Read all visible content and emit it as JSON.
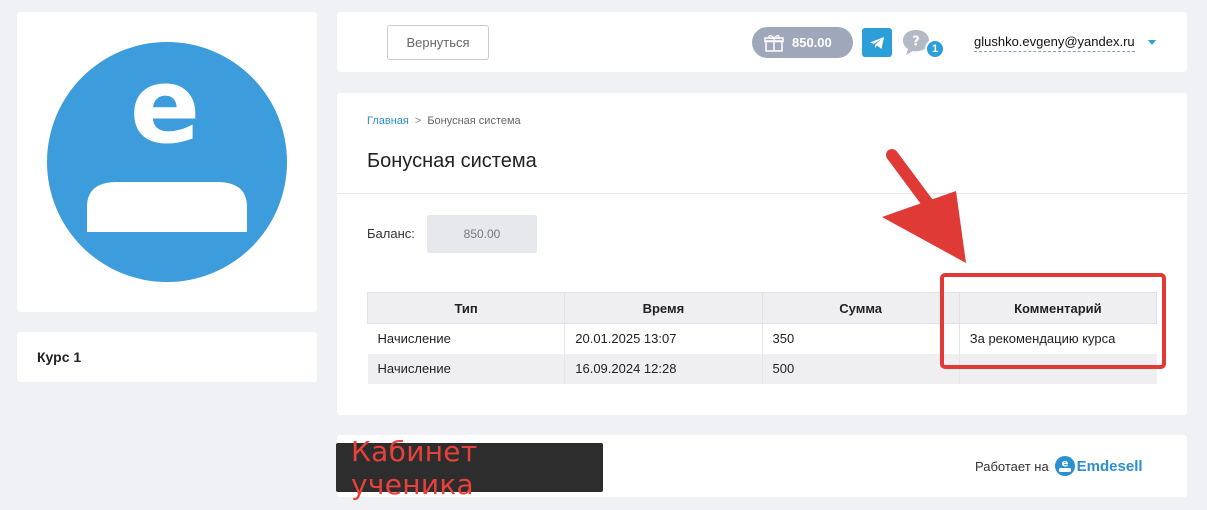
{
  "sidebar": {
    "course_label": "Курс 1"
  },
  "header": {
    "back_label": "Вернуться",
    "balance_pill": "850.00",
    "help_count": "1",
    "user_email": "glushko.evgeny@yandex.ru"
  },
  "breadcrumb": {
    "home": "Главная",
    "separator": ">",
    "current": "Бонусная система"
  },
  "page": {
    "title": "Бонусная система",
    "balance_label": "Баланс:",
    "balance_value": "850.00"
  },
  "table": {
    "columns": [
      "Тип",
      "Время",
      "Сумма",
      "Комментарий"
    ],
    "rows": [
      [
        "Начисление",
        "20.01.2025 13:07",
        "350",
        "За рекомендацию курса"
      ],
      [
        "Начисление",
        "16.09.2024 12:28",
        "500",
        ""
      ]
    ]
  },
  "footer": {
    "cabinet_label": "Кабинет ученика",
    "powered_by": "Работает на",
    "brand": "Emdesell"
  },
  "colors": {
    "accent": "#2c9ed8",
    "avatar": "#3d9cdb",
    "highlight": "#e03a36",
    "balance_pill": "#9fa7bb"
  },
  "icons": {
    "avatar": "user-avatar-icon",
    "gift": "gift-icon",
    "telegram": "telegram-icon",
    "help": "question-bubble-icon",
    "brand_logo": "emdesell-logo-icon"
  }
}
